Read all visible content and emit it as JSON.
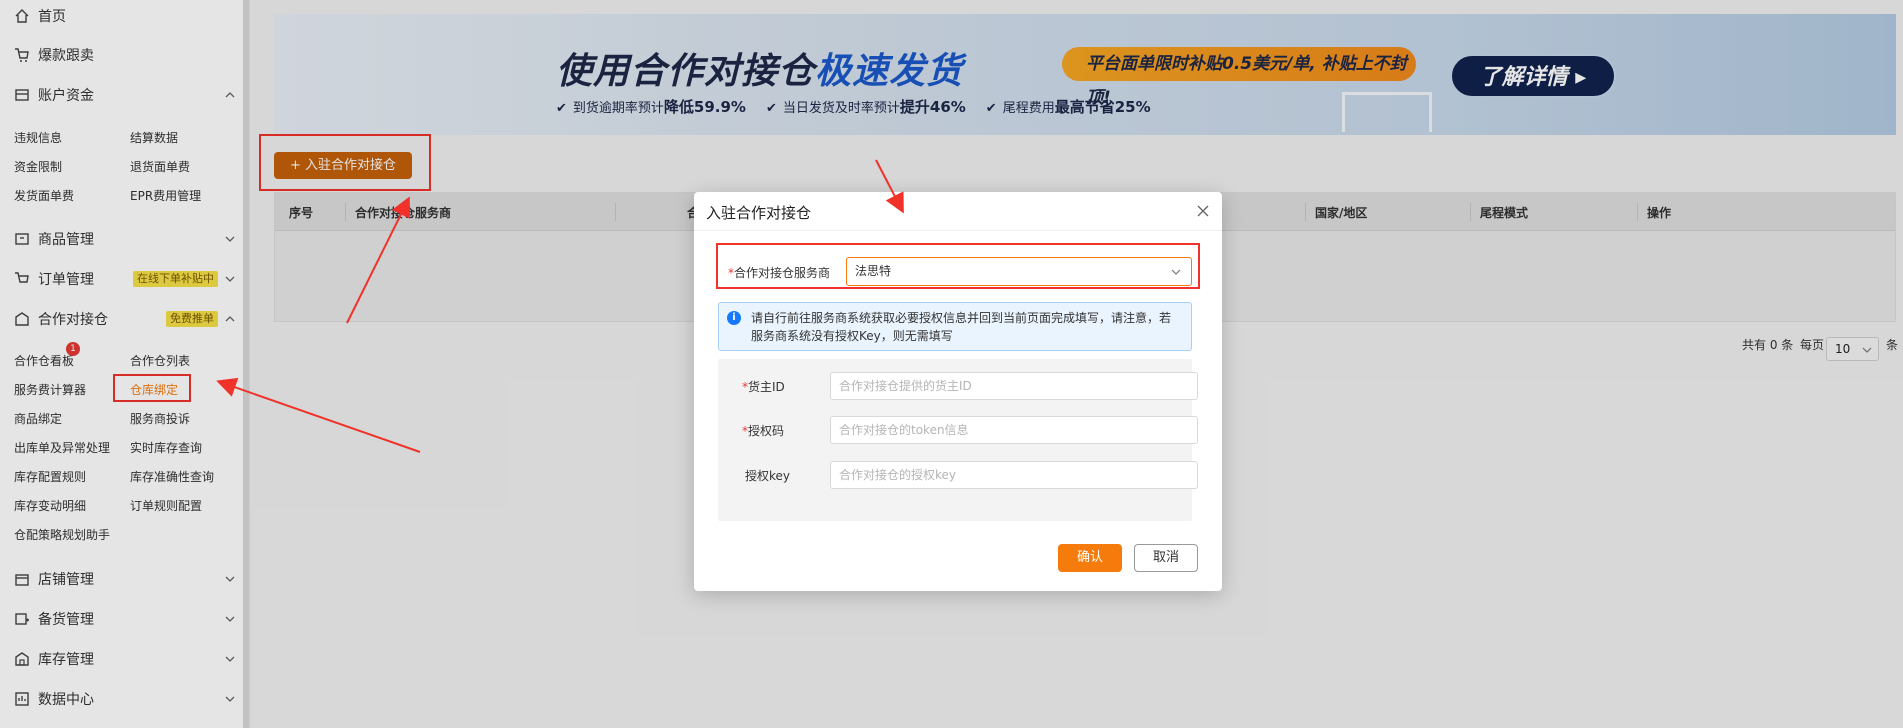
{
  "colors": {
    "accent": "#f57b0d",
    "annotation_red": "#f0322a",
    "info_blue": "#1677ff",
    "banner_navy": "#10224d"
  },
  "sidebar": {
    "home": "首页",
    "hot_products": "爆款跟卖",
    "account_funds": {
      "label": "账户资金",
      "items": [
        "违规信息",
        "结算数据",
        "资金限制",
        "退货面单费",
        "发货面单费",
        "EPR费用管理"
      ]
    },
    "product_mgmt": "商品管理",
    "order_mgmt": {
      "label": "订单管理",
      "tag": "在线下单补贴中"
    },
    "partner_wh": {
      "label": "合作对接仓",
      "tag": "免费推单",
      "badge": "1",
      "items": [
        "合作仓看板",
        "合作仓列表",
        "服务费计算器",
        "仓库绑定",
        "商品绑定",
        "服务商投诉",
        "出库单及异常处理",
        "实时库存查询",
        "库存配置规则",
        "库存准确性查询",
        "库存变动明细",
        "订单规则配置",
        "仓配策略规划助手"
      ]
    },
    "shop_mgmt": "店铺管理",
    "stock_prep": "备货管理",
    "inventory_mgmt": "库存管理",
    "data_center": "数据中心"
  },
  "banner": {
    "title_part1": "使用合作对接仓",
    "title_part2": "极速发货",
    "pill": "平台面单限时补贴0.5美元/单, 补贴上不封顶!",
    "cta": "了解详情 ▸",
    "features": [
      {
        "text": "到货逾期率预计",
        "strong": "降低59.9%"
      },
      {
        "text": "当日发货及时率预计",
        "strong": "提升46%"
      },
      {
        "text": "尾程费用",
        "strong": "最高节省25%"
      }
    ]
  },
  "main": {
    "join_button": "+ 入驻合作对接仓",
    "table_headers": [
      "序号",
      "合作对接仓服务商",
      "合",
      "国家/地区",
      "尾程模式",
      "操作"
    ],
    "pager": {
      "total": "共有 0 条",
      "per_page": "每页",
      "size": "10",
      "unit": "条"
    }
  },
  "modal": {
    "title": "入驻合作对接仓",
    "provider_label": "合作对接仓服务商",
    "provider_value": "法思特",
    "info_text": "请自行前往服务商系统获取必要授权信息并回到当前页面完成填写，请注意，若服务商系统没有授权Key，则无需填写",
    "fields": [
      {
        "label": "货主ID",
        "required": "*",
        "placeholder": "合作对接仓提供的货主ID"
      },
      {
        "label": "授权码",
        "required": "*",
        "placeholder": "合作对接仓的token信息"
      },
      {
        "label": "授权key",
        "required": "",
        "placeholder": "合作对接仓的授权key"
      }
    ],
    "confirm": "确认",
    "cancel": "取消"
  }
}
